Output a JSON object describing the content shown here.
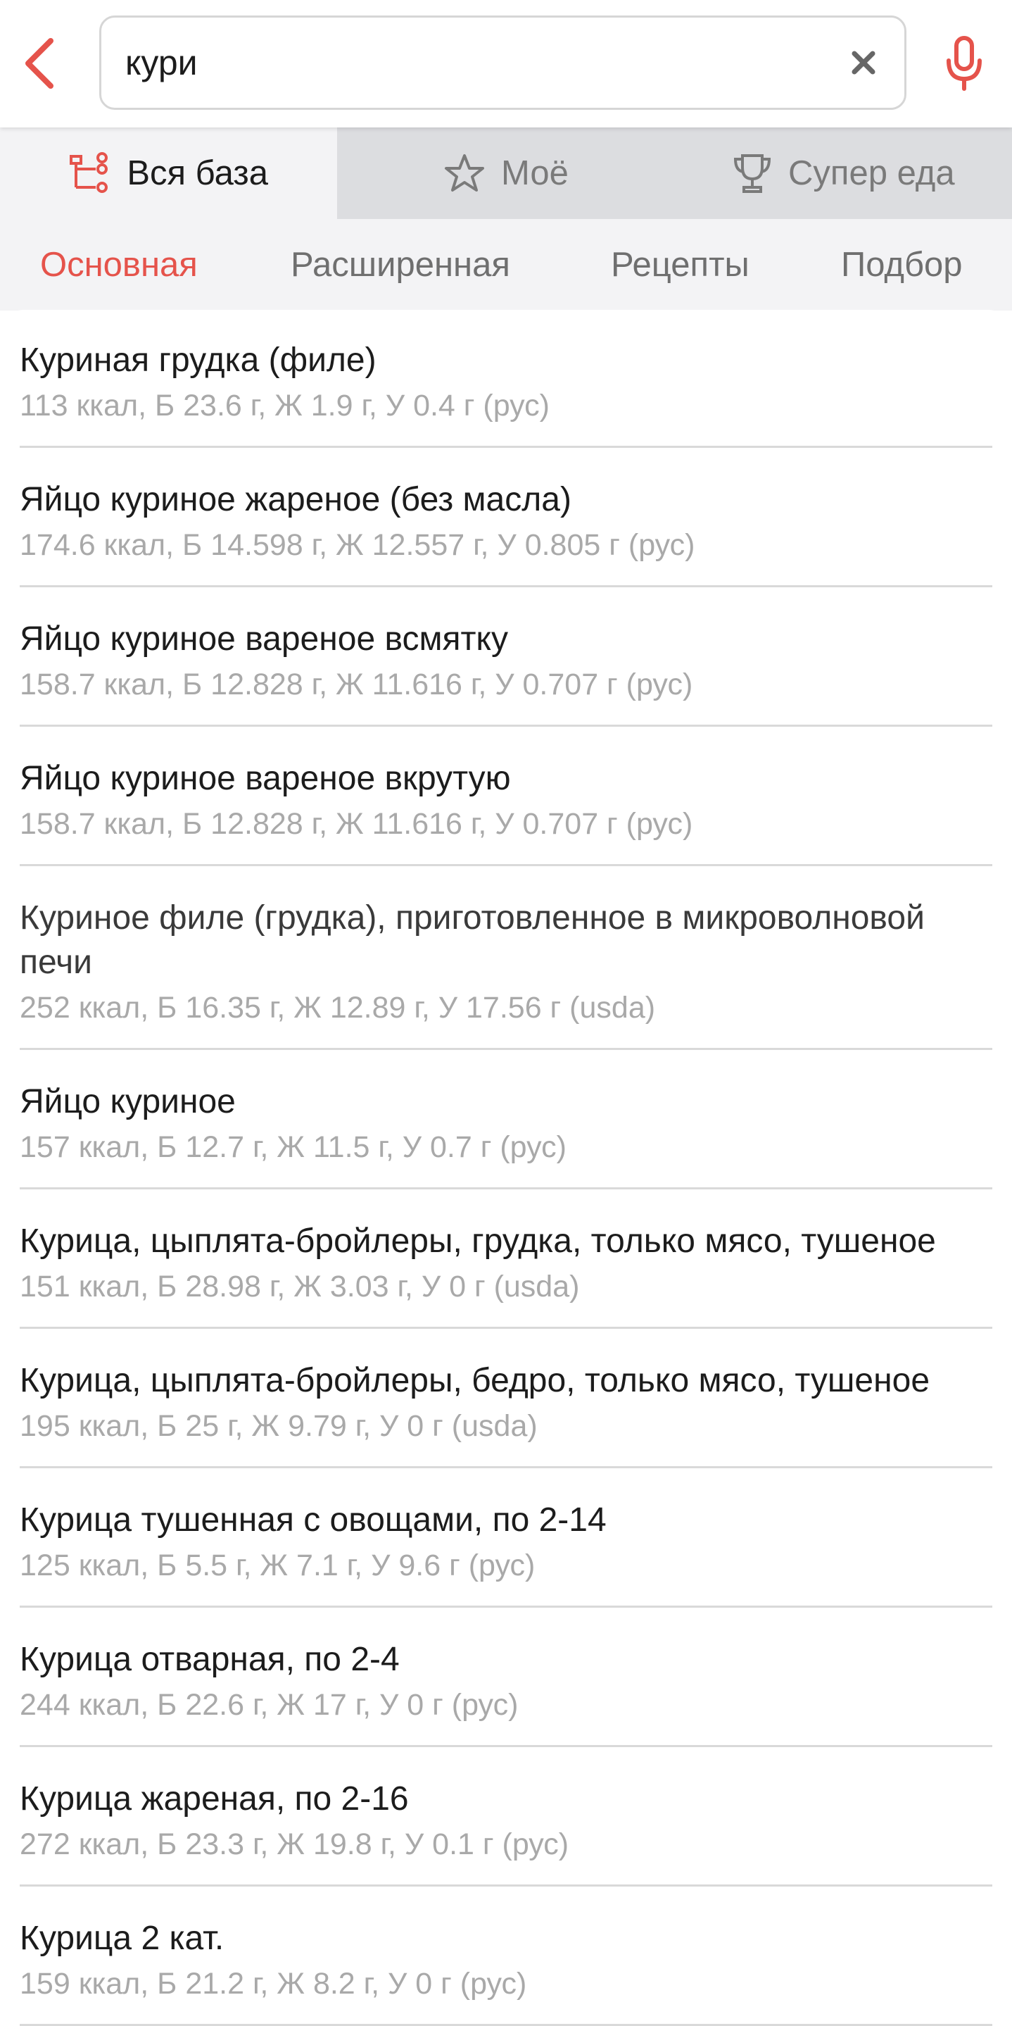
{
  "search": {
    "value": "кури"
  },
  "source_tabs": [
    {
      "label": "Вся база",
      "icon": "tree-icon",
      "active": true
    },
    {
      "label": "Моё",
      "icon": "star-icon",
      "active": false
    },
    {
      "label": "Супер еда",
      "icon": "trophy-icon",
      "active": false
    }
  ],
  "mode_tabs": [
    {
      "label": "Основная",
      "active": true
    },
    {
      "label": "Расширенная",
      "active": false
    },
    {
      "label": "Рецепты",
      "active": false
    },
    {
      "label": "Подбор",
      "active": false
    }
  ],
  "colors": {
    "accent": "#e5534b",
    "muted": "#a9a9a9",
    "tab_bg": "#dcdde0"
  },
  "results": [
    {
      "title": "Куриная грудка (филе)",
      "sub": "113 ккал, Б 23.6 г, Ж 1.9 г, У 0.4 г (рус)"
    },
    {
      "title": "Яйцо куриное жареное (без масла)",
      "sub": "174.6 ккал, Б 14.598 г, Ж 12.557 г, У 0.805 г (рус)"
    },
    {
      "title": "Яйцо куриное вареное всмятку",
      "sub": "158.7 ккал, Б 12.828 г, Ж 11.616 г, У 0.707 г (рус)"
    },
    {
      "title": "Яйцо куриное вареное вкрутую",
      "sub": "158.7 ккал, Б 12.828 г, Ж 11.616 г, У 0.707 г (рус)"
    },
    {
      "title": "Куриное филе (грудка), приготовленное в микроволновой печи",
      "sub": "252 ккал, Б 16.35 г, Ж 12.89 г, У 17.56 г (usda)"
    },
    {
      "title": "Яйцо куриное",
      "sub": "157 ккал, Б 12.7 г, Ж 11.5 г, У 0.7 г (рус)"
    },
    {
      "title": "Курица, цыплята-бройлеры, грудка, только мясо, тушеное",
      "sub": "151 ккал, Б 28.98 г, Ж 3.03 г, У 0 г (usda)"
    },
    {
      "title": "Курица, цыплята-бройлеры, бедро, только мясо, тушеное",
      "sub": "195 ккал, Б 25 г, Ж 9.79 г, У 0 г (usda)"
    },
    {
      "title": "Курица тушенная с овощами, по 2-14",
      "sub": "125 ккал, Б 5.5 г, Ж 7.1 г, У 9.6 г (рус)"
    },
    {
      "title": "Курица отварная, по 2-4",
      "sub": "244 ккал, Б 22.6 г, Ж 17 г, У 0 г (рус)"
    },
    {
      "title": "Курица жареная, по 2-16",
      "sub": "272 ккал, Б 23.3 г, Ж 19.8 г, У 0.1 г (рус)"
    },
    {
      "title": "Курица 2 кат.",
      "sub": "159 ккал, Б 21.2 г, Ж 8.2 г, У 0 г (рус)"
    }
  ]
}
